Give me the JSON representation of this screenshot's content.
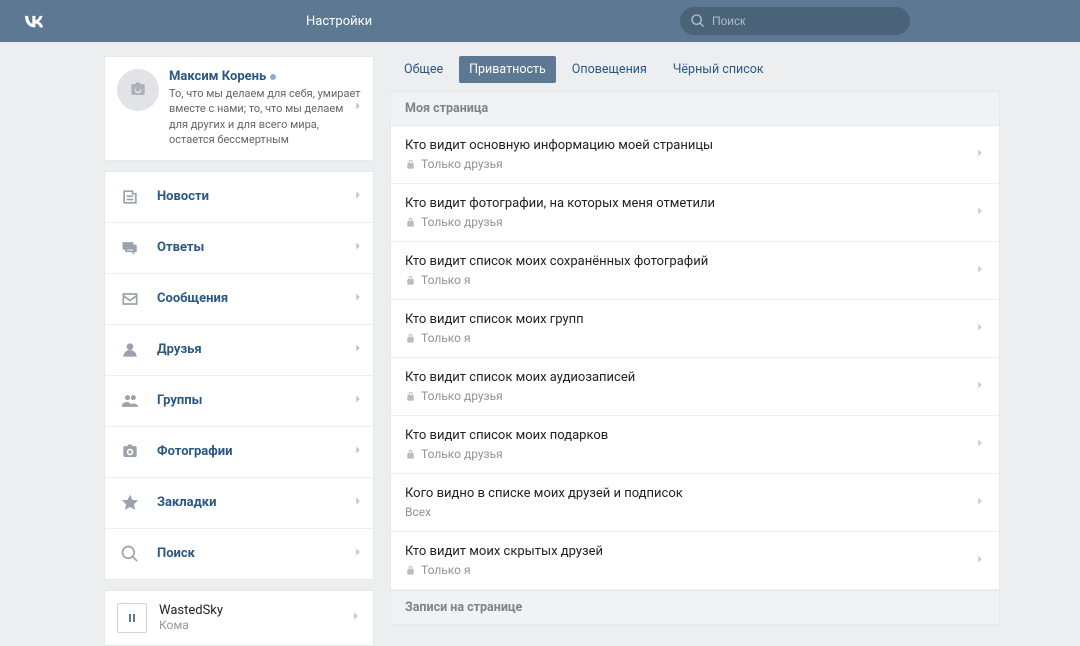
{
  "header": {
    "title": "Настройки",
    "search_placeholder": "Поиск"
  },
  "profile": {
    "name": "Максим Корень",
    "status": "То, что мы делаем для себя, умирает вместе с нами; то, что мы делаем для других и для всего мира, остается бессмертным"
  },
  "nav": [
    {
      "label": "Новости",
      "icon": "news"
    },
    {
      "label": "Ответы",
      "icon": "replies"
    },
    {
      "label": "Сообщения",
      "icon": "messages"
    },
    {
      "label": "Друзья",
      "icon": "friends"
    },
    {
      "label": "Группы",
      "icon": "groups"
    },
    {
      "label": "Фотографии",
      "icon": "photos"
    },
    {
      "label": "Закладки",
      "icon": "bookmarks"
    },
    {
      "label": "Поиск",
      "icon": "search"
    }
  ],
  "player": {
    "title": "WastedSky",
    "subtitle": "Кома"
  },
  "tabs": [
    {
      "label": "Общее",
      "active": false
    },
    {
      "label": "Приватность",
      "active": true
    },
    {
      "label": "Оповещения",
      "active": false
    },
    {
      "label": "Чёрный список",
      "active": false
    }
  ],
  "sections": [
    {
      "title": "Моя страница",
      "rows": [
        {
          "label": "Кто видит основную информацию моей страницы",
          "value": "Только друзья",
          "lock": true
        },
        {
          "label": "Кто видит фотографии, на которых меня отметили",
          "value": "Только друзья",
          "lock": true
        },
        {
          "label": "Кто видит список моих сохранённых фотографий",
          "value": "Только я",
          "lock": true
        },
        {
          "label": "Кто видит список моих групп",
          "value": "Только я",
          "lock": true
        },
        {
          "label": "Кто видит список моих аудиозаписей",
          "value": "Только друзья",
          "lock": true
        },
        {
          "label": "Кто видит список моих подарков",
          "value": "Только друзья",
          "lock": true
        },
        {
          "label": "Кого видно в списке моих друзей и подписок",
          "value": "Всех",
          "lock": false
        },
        {
          "label": "Кто видит моих скрытых друзей",
          "value": "Только я",
          "lock": true
        }
      ]
    },
    {
      "title": "Записи на странице",
      "rows": []
    }
  ]
}
